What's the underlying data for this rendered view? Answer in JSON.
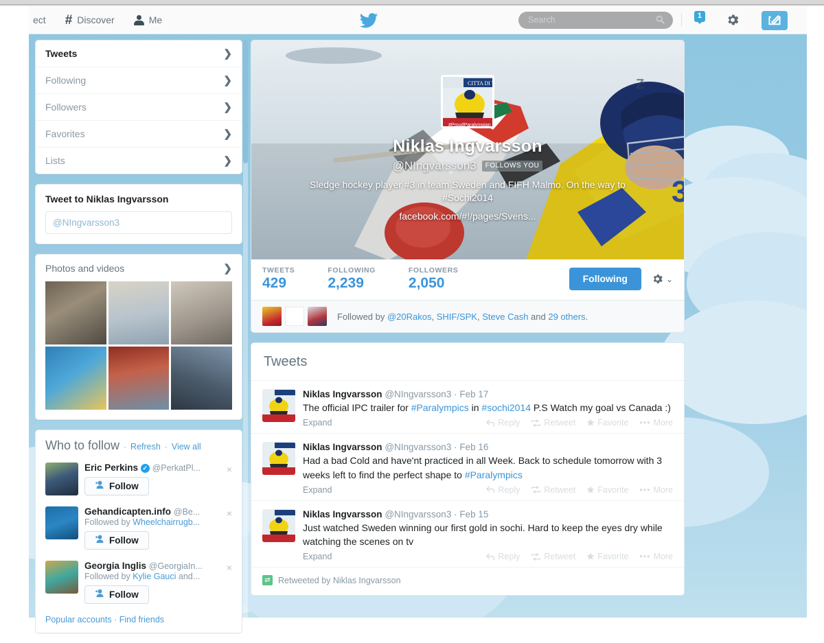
{
  "topnav": {
    "items": [
      {
        "label": "ect",
        "icon": "connect-icon",
        "clipped": true
      },
      {
        "label": "Discover",
        "icon": "hash-icon"
      },
      {
        "label": "Me",
        "icon": "person-icon"
      }
    ],
    "logo_icon": "twitter-bird-icon",
    "search_placeholder": "Search",
    "search_value": "",
    "search_icon": "search-icon",
    "notification_count": "1",
    "settings_icon": "gear-icon",
    "compose_icon": "compose-tweet-icon"
  },
  "sidebar": {
    "nav": [
      {
        "label": "Tweets",
        "active": true
      },
      {
        "label": "Following",
        "active": false
      },
      {
        "label": "Followers",
        "active": false
      },
      {
        "label": "Favorites",
        "active": false
      },
      {
        "label": "Lists",
        "active": false
      }
    ],
    "compose": {
      "title": "Tweet to Niklas Ingvarsson",
      "value": "@NIngvarsson3",
      "placeholder": "@NIngvarsson3"
    },
    "photos": {
      "title": "Photos and videos",
      "count": 6
    },
    "who_to_follow": {
      "title": "Who to follow",
      "refresh_label": "Refresh",
      "view_all_label": "View all",
      "separator": "·",
      "suggestions": [
        {
          "name": "Eric Perkins",
          "handle": "@PerkatPl...",
          "verified": true,
          "context": "",
          "context_link": "",
          "follow_label": "Follow",
          "dismiss": "×"
        },
        {
          "name": "Gehandicapten.info",
          "handle": "@Be...",
          "verified": false,
          "context_prefix": "Followed by ",
          "context_link": "Wheelchairrugb...",
          "follow_label": "Follow",
          "dismiss": "×"
        },
        {
          "name": "Georgia Inglis",
          "handle": "@GeorgiaIn...",
          "verified": false,
          "context_prefix": "Followed by ",
          "context_link": "Kylie Gauci",
          "context_suffix": " and...",
          "follow_label": "Follow",
          "dismiss": "×"
        }
      ],
      "footer_popular": "Popular accounts",
      "footer_sep": "·",
      "footer_find": "Find friends"
    }
  },
  "profile": {
    "name": "Niklas Ingvarsson",
    "handle": "@NIngvarsson3",
    "follows_you_badge": "FOLLOWS YOU",
    "bio": "Sledge hockey player #3 in team Sweden and FIFH Malmo. On the way to #Sochi2014",
    "link": "facebook.com/#!/pages/Svens...",
    "avatar_caption": "#ProudParalympian",
    "stats": [
      {
        "label": "TWEETS",
        "value": "429"
      },
      {
        "label": "FOLLOWING",
        "value": "2,239"
      },
      {
        "label": "FOLLOWERS",
        "value": "2,050"
      }
    ],
    "follow_button": "Following",
    "gear_icon": "gear-icon",
    "gear_chevron": "⌄",
    "followed_by": {
      "prefix": "Followed by ",
      "links": [
        "@20Rakos",
        "SHIF/SPK",
        "Steve Cash"
      ],
      "and": " and ",
      "others": "29 others",
      "period": "."
    }
  },
  "timeline": {
    "heading": "Tweets",
    "tweets": [
      {
        "name": "Niklas Ingvarsson",
        "handle": "@NIngvarsson3",
        "separator": "·",
        "time": "Feb 17",
        "text_parts": [
          {
            "t": "The official IPC trailer for ",
            "hash": false
          },
          {
            "t": "#Paralympics",
            "hash": true
          },
          {
            "t": " in ",
            "hash": false
          },
          {
            "t": "#sochi2014",
            "hash": true
          },
          {
            "t": " P.S Watch my goal vs Canada :)",
            "hash": false
          }
        ],
        "expand": "Expand",
        "actions": [
          "Reply",
          "Retweet",
          "Favorite",
          "More"
        ]
      },
      {
        "name": "Niklas Ingvarsson",
        "handle": "@NIngvarsson3",
        "separator": "·",
        "time": "Feb 16",
        "text_parts": [
          {
            "t": "Had a bad Cold and have'nt practiced in all Week. Back to schedule tomorrow with 3 weeks left to find the perfect shape to ",
            "hash": false
          },
          {
            "t": "#Paralympics",
            "hash": true
          }
        ],
        "expand": "Expand",
        "actions": [
          "Reply",
          "Retweet",
          "Favorite",
          "More"
        ]
      },
      {
        "name": "Niklas Ingvarsson",
        "handle": "@NIngvarsson3",
        "separator": "·",
        "time": "Feb 15",
        "text_parts": [
          {
            "t": "Just watched Sweden winning our first gold in sochi. Hard to keep the eyes dry while watching the scenes on tv",
            "hash": false
          }
        ],
        "expand": "Expand",
        "actions": [
          "Reply",
          "Retweet",
          "Favorite",
          "More"
        ]
      }
    ],
    "retweet_footer": "Retweeted by Niklas Ingvarsson",
    "retweet_icon": "retweet-icon"
  },
  "colors": {
    "accent": "#3b94d9",
    "link": "#4a9ad4",
    "muted": "#8899a6",
    "sky": "#8ec6e0",
    "verified": "#1da1f2"
  }
}
